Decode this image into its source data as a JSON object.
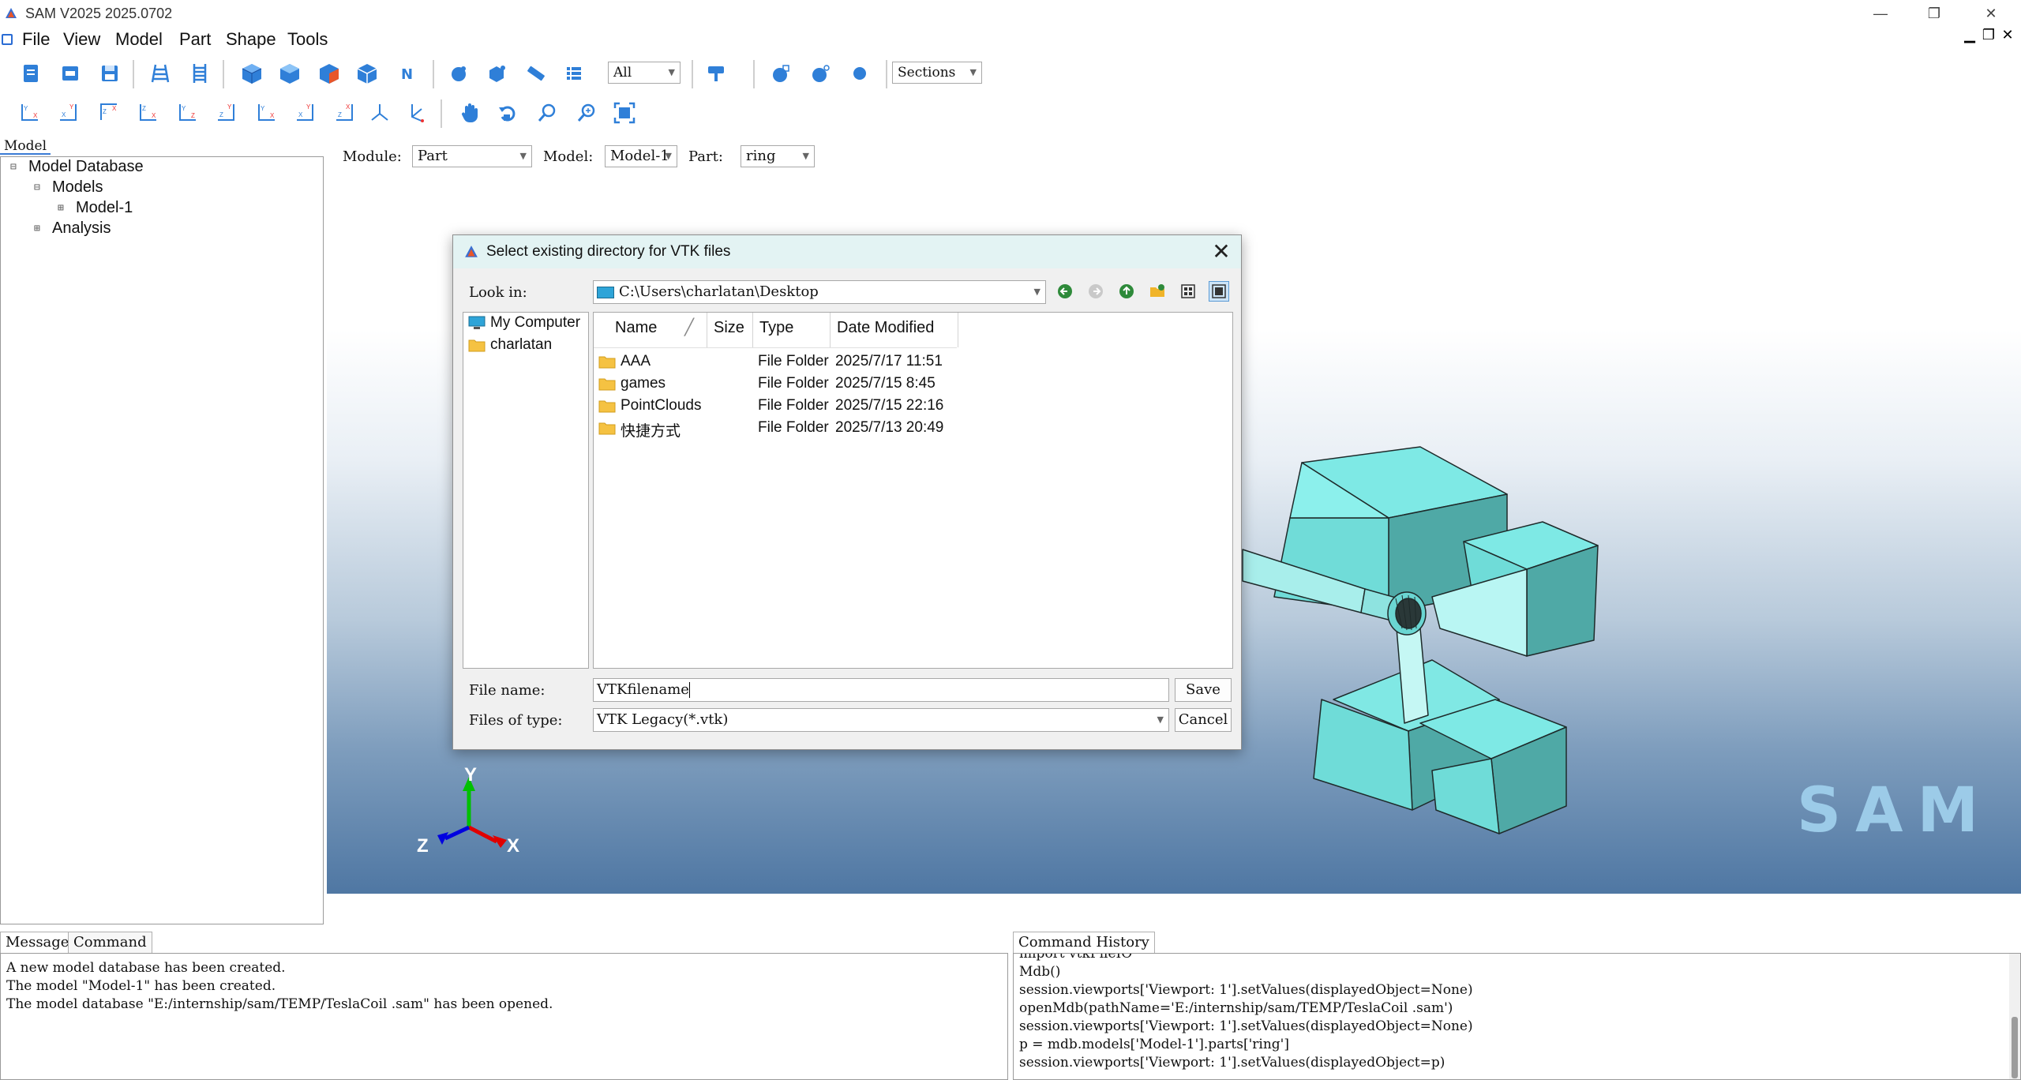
{
  "window": {
    "title": "SAM V2025   2025.0702",
    "minimize": "—",
    "maximize": "❐",
    "close": "✕"
  },
  "menu": [
    "File",
    "View",
    "Model",
    "Part",
    "Shape",
    "Tools"
  ],
  "toolbar": {
    "filter_value": "All",
    "sections_value": "Sections",
    "icons_row1": [
      "new-file-icon",
      "open-file-icon",
      "save-file-icon",
      "mesh-tower-icon",
      "mesh-ladder-icon",
      "solid-view-icon",
      "shaded-view-icon",
      "wire-shade-icon",
      "hidden-view-icon",
      "normals-icon",
      "sphere-shape-icon",
      "cube-shape-icon",
      "ruler-icon",
      "list-icon",
      "paint-icon",
      "render-cube-icon",
      "render-sphere-icon",
      "render-dot-icon"
    ],
    "icons_row2": [
      "view-yx-icon",
      "view-xy-icon",
      "view-zx-icon",
      "view-xz-icon",
      "view-yz-icon",
      "view-zy-icon",
      "view-iso1-icon",
      "view-iso2-icon",
      "view-iso3-icon",
      "view-iso-axes-icon",
      "view-axes-icon",
      "pan-hand-icon",
      "rotate-icon",
      "zoom-icon",
      "zoom-box-icon",
      "fit-view-icon"
    ]
  },
  "tree": {
    "tab": "Model",
    "root": "Model Database",
    "models": "Models",
    "model1": "Model-1",
    "analysis": "Analysis",
    "minus": "⊟",
    "plus": "⊞"
  },
  "module_bar": {
    "module_label": "Module:",
    "module_value": "Part",
    "model_label": "Model:",
    "model_value": "Model-1",
    "part_label": "Part:",
    "part_value": "ring"
  },
  "viewport": {
    "watermark": "SAM",
    "axis_y": "Y",
    "axis_z": "Z",
    "axis_x": "X",
    "color_top": "#ffffff",
    "color_bottom": "#4f77a3",
    "model_color": "#6fe0dc"
  },
  "dialog": {
    "title": "Select existing directory for VTK files",
    "close": "✕",
    "look_in_label": "Look in:",
    "look_in_value": "C:\\Users\\charlatan\\Desktop",
    "sidebar": [
      "My Computer",
      "charlatan"
    ],
    "columns": [
      "Name",
      "Size",
      "Type",
      "Date Modified"
    ],
    "rows": [
      {
        "name": "AAA",
        "type": "File Folder",
        "date": "2025/7/17 11:51"
      },
      {
        "name": "games",
        "type": "File Folder",
        "date": "2025/7/15 8:45"
      },
      {
        "name": "PointClouds",
        "type": "File Folder",
        "date": "2025/7/15 22:16"
      },
      {
        "name": "快捷方式",
        "type": "File Folder",
        "date": "2025/7/13 20:49"
      }
    ],
    "file_name_label": "File name:",
    "file_name_value": "VTKfilename",
    "files_type_label": "Files of type:",
    "files_type_value": "VTK Legacy(*.vtk)",
    "save": "Save",
    "cancel": "Cancel"
  },
  "bottom": {
    "tabs": [
      "Message",
      "Command"
    ],
    "history_title": "Command History",
    "messages": [
      "A new model database has been created.",
      "The model \"Model-1\" has been created.",
      "The model database \"E:/internship/sam/TEMP/TeslaCoil .sam\" has been opened."
    ],
    "history": [
      "import vtkFileIO",
      "Mdb()",
      "session.viewports['Viewport: 1'].setValues(displayedObject=None)",
      "openMdb(pathName='E:/internship/sam/TEMP/TeslaCoil .sam')",
      "session.viewports['Viewport: 1'].setValues(displayedObject=None)",
      "p = mdb.models['Model-1'].parts['ring']",
      "session.viewports['Viewport: 1'].setValues(displayedObject=p)"
    ]
  }
}
